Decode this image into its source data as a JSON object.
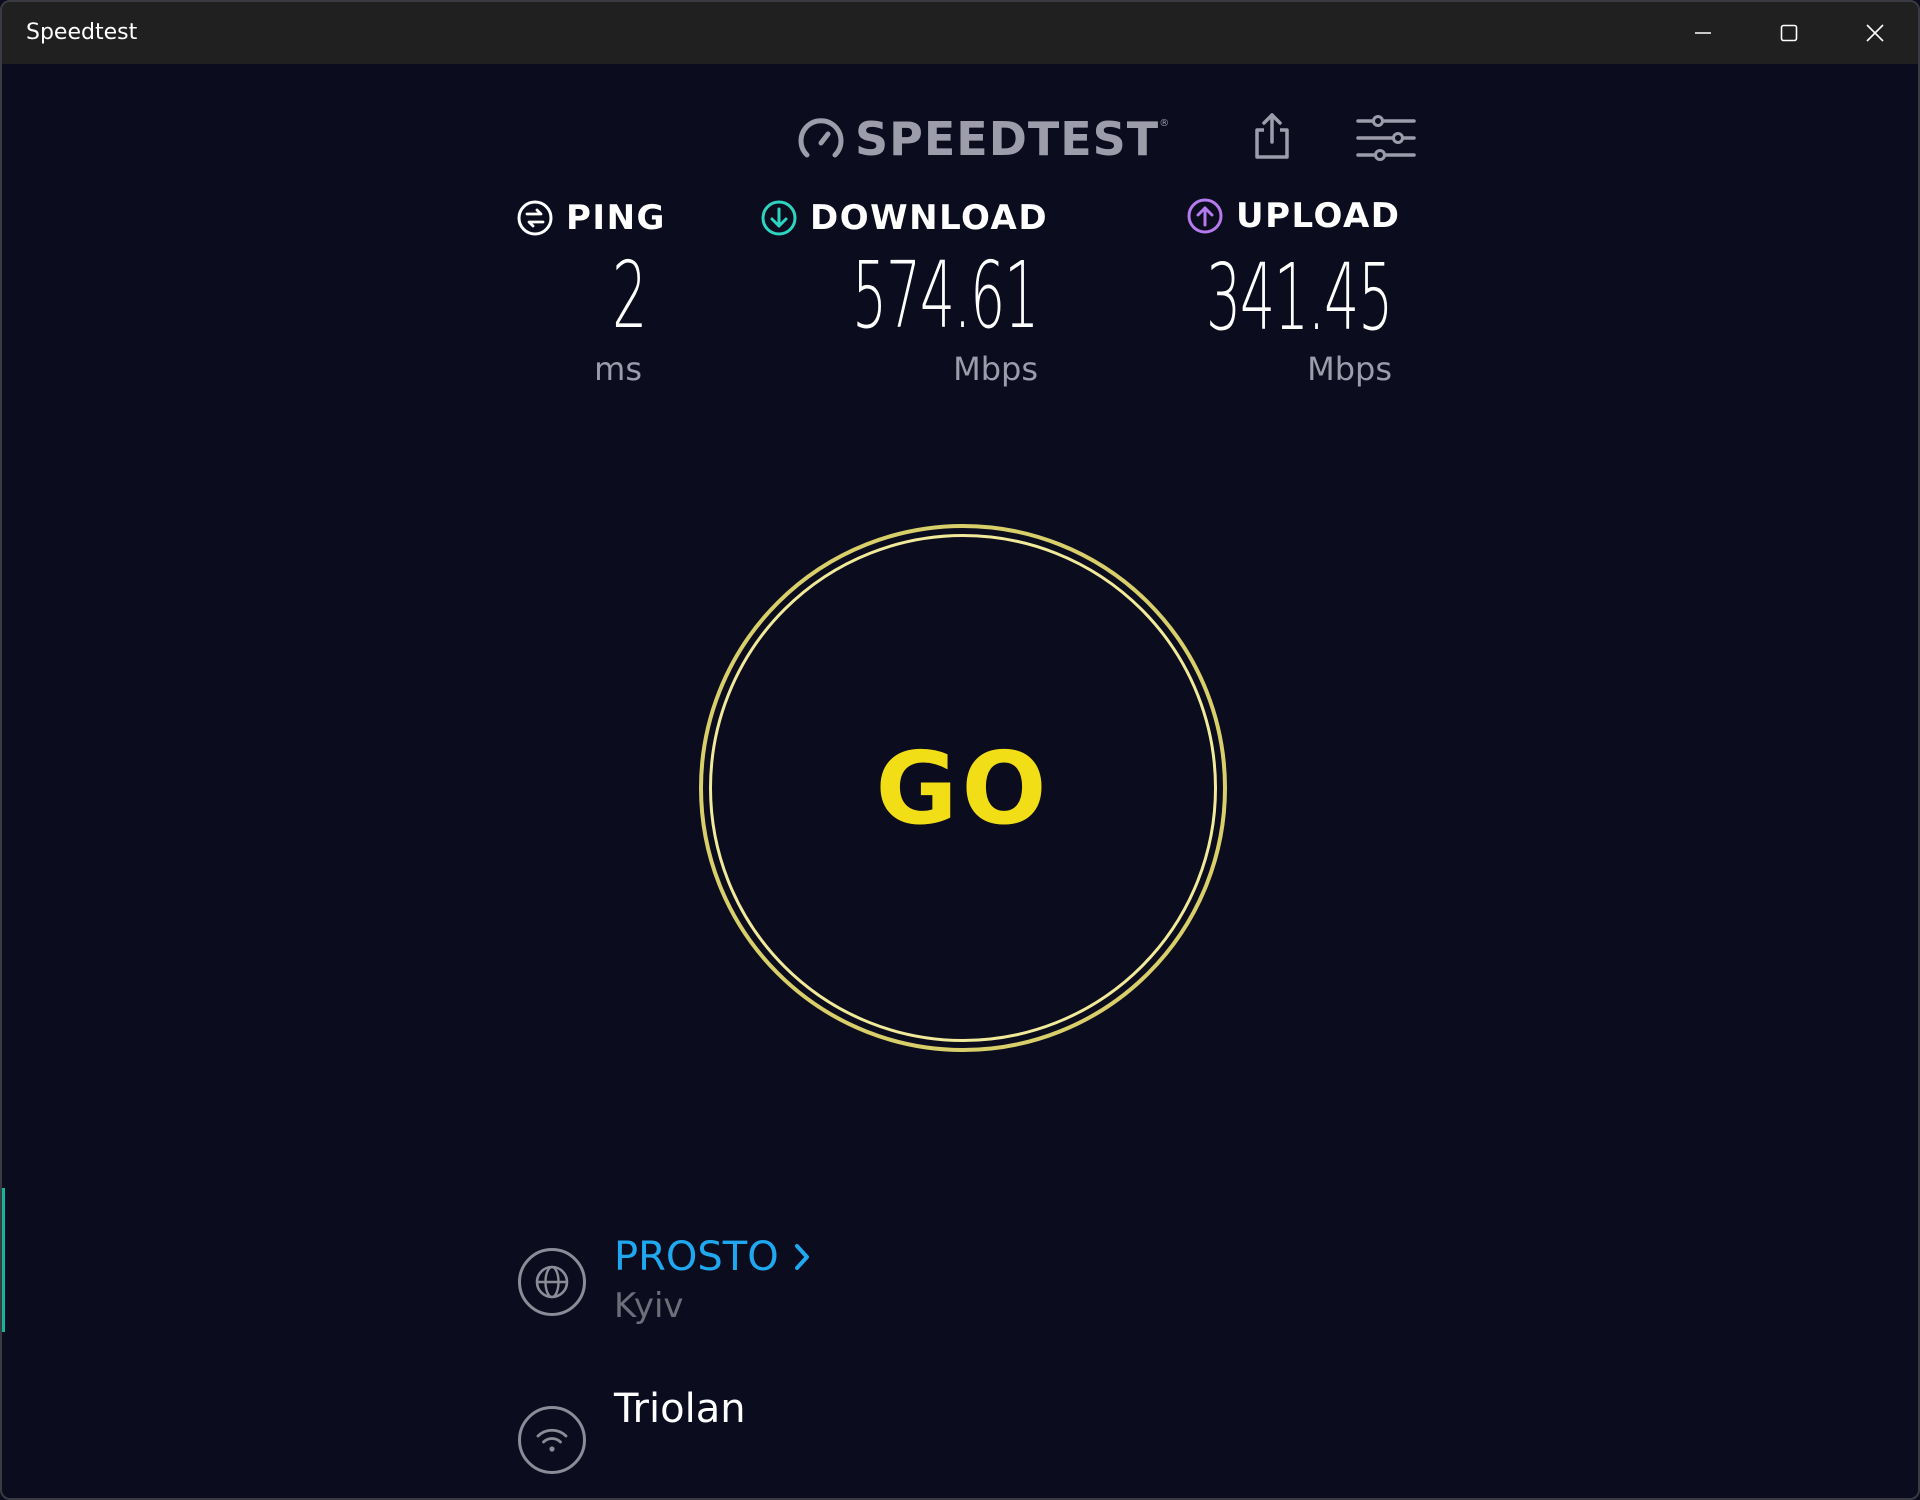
{
  "window": {
    "title": "Speedtest",
    "controls": [
      "minimize-icon",
      "maximize-icon",
      "close-icon"
    ]
  },
  "header": {
    "logo_text": "SPEEDTEST",
    "logo_mark": "®",
    "logo_icon": "speedometer-icon",
    "share_icon": "share-icon",
    "settings_icon": "sliders-icon"
  },
  "metrics": {
    "ping": {
      "label": "PING",
      "value": "2",
      "unit": "ms",
      "icon": "ping-icon",
      "color": "#ffffff"
    },
    "download": {
      "label": "DOWNLOAD",
      "value": "574.61",
      "unit": "Mbps",
      "icon": "download-icon",
      "color": "#2dd4bf"
    },
    "upload": {
      "label": "UPLOAD",
      "value": "341.45",
      "unit": "Mbps",
      "icon": "upload-icon",
      "color": "#b57aef"
    }
  },
  "go_button": {
    "label": "GO",
    "ring_color": "#d8cf6a",
    "text_color": "#f2de17"
  },
  "server": {
    "provider": "PROSTO",
    "city": "Kyiv",
    "icon": "globe-icon",
    "link_color": "#1fa8f0"
  },
  "connection": {
    "isp": "Triolan",
    "icon": "wifi-icon"
  }
}
